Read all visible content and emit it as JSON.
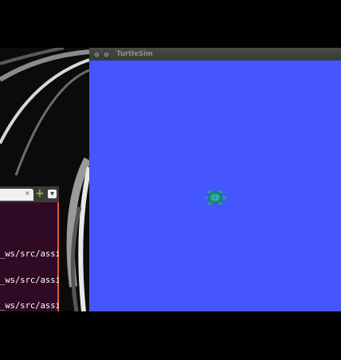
{
  "turtlesim": {
    "title": "TurtleSim",
    "canvas_color": "#4556ff"
  },
  "terminal": {
    "tab_close": "×",
    "tab_add": "+",
    "tab_menu": "▼",
    "lines": [
      "_ws/src/assi",
      "_ws/src/assi",
      "_ws/src/assi"
    ]
  },
  "icons": {
    "turtle": "turtle-icon",
    "close": "close-icon",
    "minimize": "minimize-icon"
  }
}
